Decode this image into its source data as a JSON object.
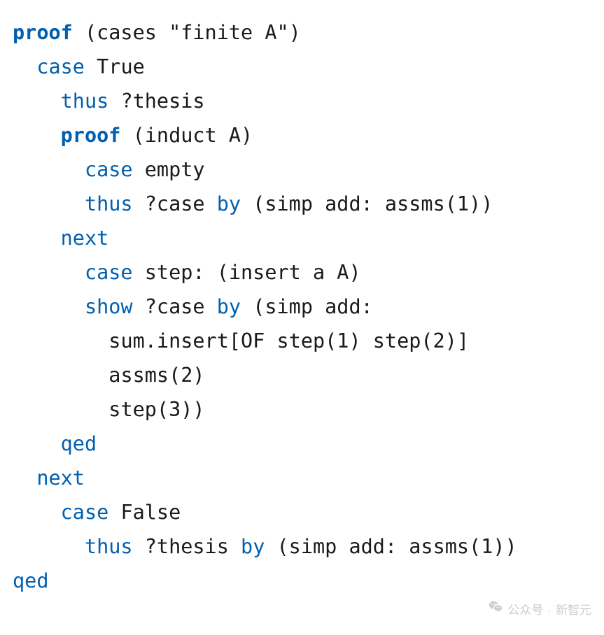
{
  "watermark": {
    "label_prefix": "公众号",
    "label_sep": "·",
    "label_name": "新智元"
  },
  "code": {
    "lines": [
      {
        "indent": 0,
        "tokens": [
          {
            "cls": "kw-bold",
            "t": "proof"
          },
          {
            "cls": "txt",
            "t": " (cases \"finite A\")"
          }
        ]
      },
      {
        "indent": 1,
        "tokens": [
          {
            "cls": "kw",
            "t": "case"
          },
          {
            "cls": "txt",
            "t": " True"
          }
        ]
      },
      {
        "indent": 2,
        "tokens": [
          {
            "cls": "kw",
            "t": "thus"
          },
          {
            "cls": "txt",
            "t": " ?thesis"
          }
        ]
      },
      {
        "indent": 2,
        "tokens": [
          {
            "cls": "kw-bold",
            "t": "proof"
          },
          {
            "cls": "txt",
            "t": " (induct A)"
          }
        ]
      },
      {
        "indent": 3,
        "tokens": [
          {
            "cls": "kw",
            "t": "case"
          },
          {
            "cls": "txt",
            "t": " empty"
          }
        ]
      },
      {
        "indent": 3,
        "tokens": [
          {
            "cls": "kw",
            "t": "thus"
          },
          {
            "cls": "txt",
            "t": " ?case "
          },
          {
            "cls": "kw",
            "t": "by"
          },
          {
            "cls": "txt",
            "t": " (simp add: assms(1))"
          }
        ]
      },
      {
        "indent": 2,
        "tokens": [
          {
            "cls": "kw",
            "t": "next"
          }
        ]
      },
      {
        "indent": 3,
        "tokens": [
          {
            "cls": "kw",
            "t": "case"
          },
          {
            "cls": "txt",
            "t": " step: (insert a A)"
          }
        ]
      },
      {
        "indent": 3,
        "tokens": [
          {
            "cls": "kw",
            "t": "show"
          },
          {
            "cls": "txt",
            "t": " ?case "
          },
          {
            "cls": "kw",
            "t": "by"
          },
          {
            "cls": "txt",
            "t": " (simp add:"
          }
        ]
      },
      {
        "indent": 4,
        "tokens": [
          {
            "cls": "txt",
            "t": "sum.insert[OF step(1) step(2)]"
          }
        ]
      },
      {
        "indent": 4,
        "tokens": [
          {
            "cls": "txt",
            "t": "assms(2)"
          }
        ]
      },
      {
        "indent": 4,
        "tokens": [
          {
            "cls": "txt",
            "t": "step(3))"
          }
        ]
      },
      {
        "indent": 2,
        "tokens": [
          {
            "cls": "kw",
            "t": "qed"
          }
        ]
      },
      {
        "indent": 1,
        "tokens": [
          {
            "cls": "kw",
            "t": "next"
          }
        ]
      },
      {
        "indent": 2,
        "tokens": [
          {
            "cls": "kw",
            "t": "case"
          },
          {
            "cls": "txt",
            "t": " False"
          }
        ]
      },
      {
        "indent": 3,
        "tokens": [
          {
            "cls": "kw",
            "t": "thus"
          },
          {
            "cls": "txt",
            "t": " ?thesis "
          },
          {
            "cls": "kw",
            "t": "by"
          },
          {
            "cls": "txt",
            "t": " (simp add: assms(1))"
          }
        ]
      },
      {
        "indent": 0,
        "tokens": [
          {
            "cls": "kw",
            "t": "qed"
          }
        ]
      }
    ],
    "indent_unit": "  "
  }
}
